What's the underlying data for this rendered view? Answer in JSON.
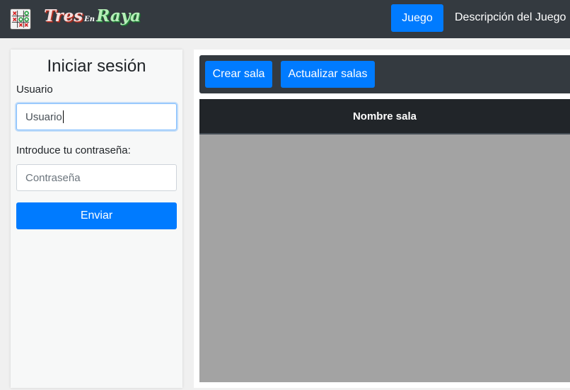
{
  "navbar": {
    "logo_icon": "tic-tac-toe-board-icon",
    "brand": {
      "word1": "Tres",
      "word2": "En",
      "word3": "Raya"
    },
    "nav_active_label": "Juego",
    "nav_link_label": "Descripción del Juego"
  },
  "login": {
    "title": "Iniciar sesión",
    "user_label": "Usuario",
    "user_value": "Usuario",
    "password_label": "Introduce tu contraseña:",
    "password_placeholder": "Contraseña",
    "submit_label": "Enviar"
  },
  "rooms": {
    "create_label": "Crear sala",
    "refresh_label": "Actualizar salas",
    "column_header": "Nombre sala",
    "rows": []
  },
  "colors": {
    "navbar_bg": "#343a40",
    "primary": "#007bff",
    "table_header_bg": "#212529",
    "table_body_bg": "#a3a3a3"
  }
}
